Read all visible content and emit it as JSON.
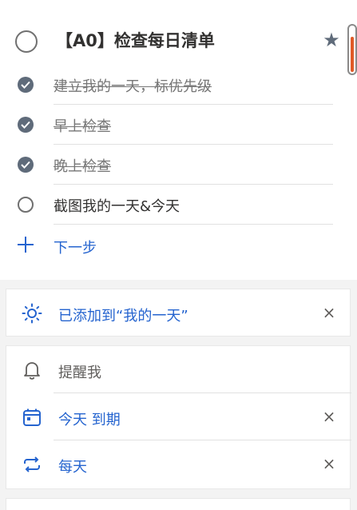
{
  "task": {
    "title": "【A0】检查每日清单",
    "steps": [
      {
        "label": "建立我的一天，标优先级",
        "done": true
      },
      {
        "label": "早上检查",
        "done": true
      },
      {
        "label": "晚上检查",
        "done": true
      },
      {
        "label": "截图我的一天&今天",
        "done": false
      }
    ],
    "next_step_label": "下一步"
  },
  "my_day": {
    "label": "已添加到“我的一天”",
    "close": "×"
  },
  "reminders": {
    "remind_label": "提醒我",
    "due_label": "今天 到期",
    "repeat_label": "每天",
    "close": "×"
  },
  "icons": {
    "star": "★"
  },
  "colors": {
    "accent": "#2564cf",
    "scroll_thumb": "#e05a28",
    "check_fill": "#5f6b7a"
  }
}
